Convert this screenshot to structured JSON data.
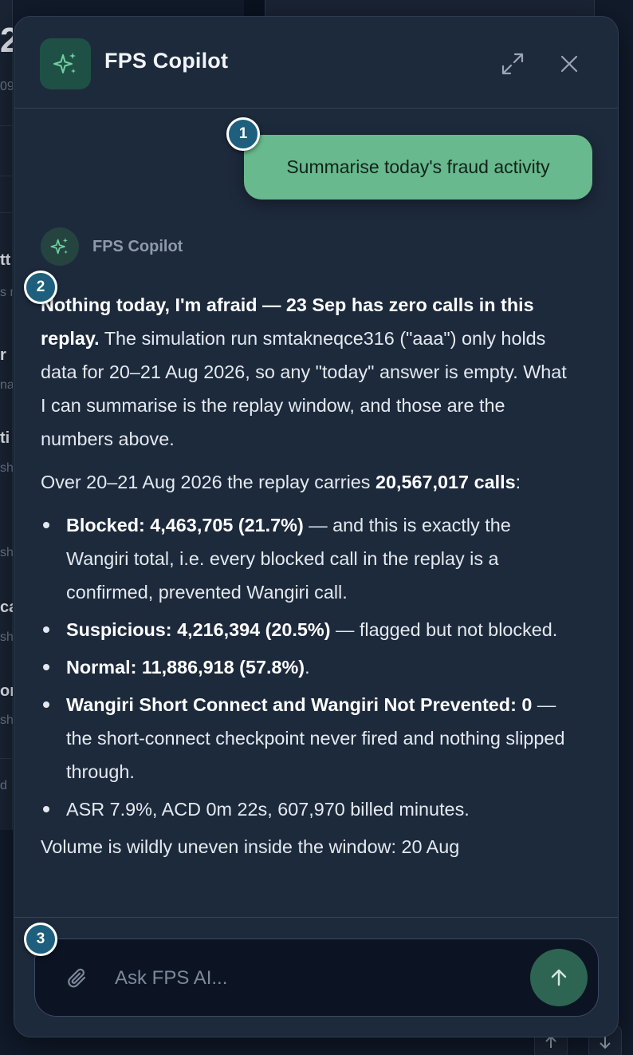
{
  "background": {
    "fragments": [
      "2",
      "09",
      "tt",
      "s n",
      "r",
      "na",
      "ti",
      "sh",
      "sh",
      "ca",
      "sh",
      "or",
      "sh",
      "d"
    ]
  },
  "copilot": {
    "title": "FPS Copilot",
    "user_message": "Summarise today's fraud activity",
    "assistant_name": "FPS Copilot",
    "answer": {
      "p1_bold": "Nothing today, I'm afraid — 23 Sep has zero calls in this replay.",
      "p1_rest": " The simulation run smtakneqce316 (\"aaa\") only holds data for 20–21 Aug 2026, so any \"today\" answer is empty. What I can summarise is the replay window, and those are the numbers above.",
      "p2_pre": "Over 20–21 Aug 2026 the replay carries ",
      "p2_bold": "20,567,017 calls",
      "p2_post": ":",
      "bullets": [
        {
          "bold": "Blocked: 4,463,705 (21.7%)",
          "rest": " — and this is exactly the Wangiri total, i.e. every blocked call in the replay is a confirmed, prevented Wangiri call."
        },
        {
          "bold": "Suspicious: 4,216,394 (20.5%)",
          "rest": " — flagged but not blocked."
        },
        {
          "bold": "Normal: 11,886,918 (57.8%)",
          "rest": "."
        },
        {
          "bold": "Wangiri Short Connect and Wangiri Not Prevented: 0",
          "rest": " — the short-connect checkpoint never fired and nothing slipped through."
        },
        {
          "bold": "",
          "rest": "ASR 7.9%, ACD 0m 22s, 607,970 billed minutes."
        }
      ],
      "p3": "Volume is wildly uneven inside the window: 20 Aug"
    },
    "input_placeholder": "Ask FPS AI...",
    "input_value": ""
  },
  "markers": [
    "1",
    "2",
    "3"
  ],
  "colors": {
    "panel_bg": "#1d2a3c",
    "user_bubble": "#68b98d",
    "accent_green": "#6fd1a0",
    "marker_bg": "#1d5f7c",
    "send_button": "#2e6552"
  },
  "icons": [
    "sparkle-icon",
    "expand-icon",
    "close-icon",
    "paperclip-icon",
    "arrow-up-icon"
  ]
}
